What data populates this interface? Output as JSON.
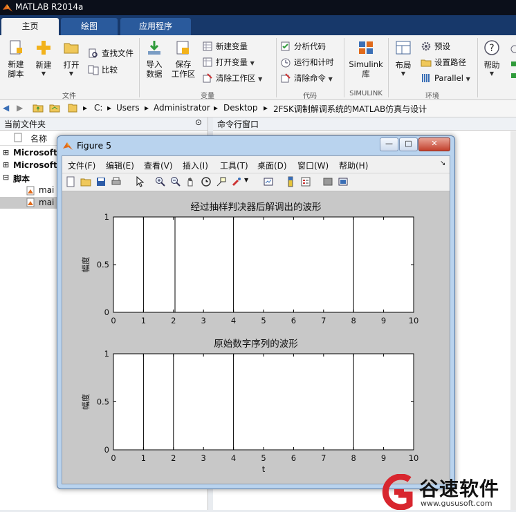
{
  "app": {
    "title": "MATLAB R2014a"
  },
  "tabs": [
    {
      "label": "主页",
      "active": true
    },
    {
      "label": "绘图",
      "active": false
    },
    {
      "label": "应用程序",
      "active": false
    }
  ],
  "ribbon": {
    "file_group": {
      "label": "文件",
      "new_script": "新建\n脚本",
      "new": "新建",
      "open": "打开",
      "find_files": "查找文件",
      "compare": "比较"
    },
    "variable_group": {
      "label": "变量",
      "import": "导入\n数据",
      "save_workspace": "保存\n工作区",
      "new_variable": "新建变量",
      "open_variable": "打开变量",
      "clear_workspace": "清除工作区"
    },
    "code_group": {
      "label": "代码",
      "analyze": "分析代码",
      "run_time": "运行和计时",
      "clear_commands": "清除命令"
    },
    "simulink_group": {
      "label": "SIMULINK",
      "simulink": "Simulink\n库"
    },
    "env_group": {
      "label": "环境",
      "layout": "布局",
      "preferences": "预设",
      "set_path": "设置路径",
      "parallel": "Parallel"
    },
    "help": "帮助"
  },
  "address": {
    "segments": [
      "C:",
      "Users",
      "Administrator",
      "Desktop",
      "2FSK调制解调系统的MATLAB仿真与设计"
    ]
  },
  "left_pane": {
    "title": "当前文件夹",
    "col_name": "名称",
    "items": [
      "Microsoft",
      "Microsoft",
      "脚本",
      "mai",
      "mai"
    ]
  },
  "right_pane": {
    "title": "命令行窗口"
  },
  "figure": {
    "title": "Figure 5",
    "menu": [
      "文件(F)",
      "编辑(E)",
      "查看(V)",
      "插入(I)",
      "工具(T)",
      "桌面(D)",
      "窗口(W)",
      "帮助(H)"
    ],
    "window_buttons": {
      "minimize": "—",
      "maximize": "□",
      "close": "✕"
    }
  },
  "chart_data": [
    {
      "type": "line",
      "title": "经过抽样判决器后解调出的波形",
      "xlabel": "",
      "ylabel": "幅度",
      "xlim": [
        0,
        10
      ],
      "ylim": [
        0,
        1
      ],
      "xticks": [
        0,
        1,
        2,
        3,
        4,
        5,
        6,
        7,
        8,
        9,
        10
      ],
      "yticks": [
        0,
        0.5,
        1
      ],
      "x": [
        0,
        0,
        1,
        1,
        2.05,
        2.05,
        4,
        4,
        8,
        8,
        10
      ],
      "y": [
        0,
        1,
        1,
        0,
        0,
        1,
        1,
        0,
        0,
        1,
        1
      ]
    },
    {
      "type": "line",
      "title": "原始数字序列的波形",
      "xlabel": "t",
      "ylabel": "幅度",
      "xlim": [
        0,
        10
      ],
      "ylim": [
        0,
        1
      ],
      "xticks": [
        0,
        1,
        2,
        3,
        4,
        5,
        6,
        7,
        8,
        9,
        10
      ],
      "yticks": [
        0,
        0.5,
        1
      ],
      "x": [
        0,
        0,
        1,
        1,
        2,
        2,
        4,
        4,
        8,
        8,
        10
      ],
      "y": [
        0,
        1,
        1,
        0,
        0,
        1,
        1,
        0,
        0,
        1,
        1
      ]
    }
  ],
  "watermark": {
    "name": "谷速软件",
    "url": "www.gususoft.com"
  },
  "colors": {
    "titlebar": "#0b0f1a",
    "tabstrip": "#17386a",
    "accent": "#d8262e"
  }
}
